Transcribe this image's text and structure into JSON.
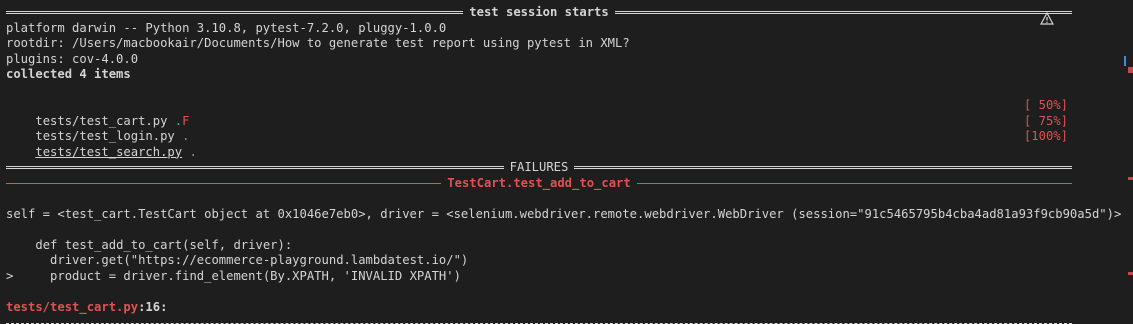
{
  "session": {
    "header_title": "test session starts",
    "platform_line": "platform darwin -- Python 3.10.8, pytest-7.2.0, pluggy-1.0.0",
    "rootdir_line": "rootdir: /Users/macbookair/Documents/How to generate test report using pytest in XML?",
    "plugins_line": "plugins: cov-4.0.0",
    "collected_line": "collected 4 items"
  },
  "results": [
    {
      "file": "tests/test_cart.py",
      "marks_pass": ".",
      "marks_fail": "F",
      "percent": "[ 50%]"
    },
    {
      "file": "tests/test_login.py",
      "marks_pass": ".",
      "marks_fail": "",
      "percent": "[ 75%]"
    },
    {
      "file": "tests/test_search.py",
      "marks_pass": ".",
      "marks_fail": "",
      "percent": "[100%]"
    }
  ],
  "failures": {
    "header_title": "FAILURES",
    "test_title": "TestCart.test_add_to_cart",
    "self_line": "self = <test_cart.TestCart object at 0x1046e7eb0>, driver = <selenium.webdriver.remote.webdriver.WebDriver (session=\"91c5465795b4cba4ad81a93f9cb90a5d\")>",
    "code": [
      {
        "prefix": "    ",
        "text": "def test_add_to_cart(self, driver):"
      },
      {
        "prefix": "      ",
        "text": "driver.get(\"https://ecommerce-playground.lambdatest.io/\")"
      },
      {
        "prefix": ">     ",
        "text": "product = driver.find_element(By.XPATH, 'INVALID XPATH')"
      }
    ],
    "location_file": "tests/test_cart.py",
    "location_line": ":16:"
  },
  "colors": {
    "background": "#1e1e1e",
    "text": "#d4d4d4",
    "error": "#e05252",
    "pass": "#56b86a"
  },
  "icons": {
    "warning": "warning-icon"
  }
}
